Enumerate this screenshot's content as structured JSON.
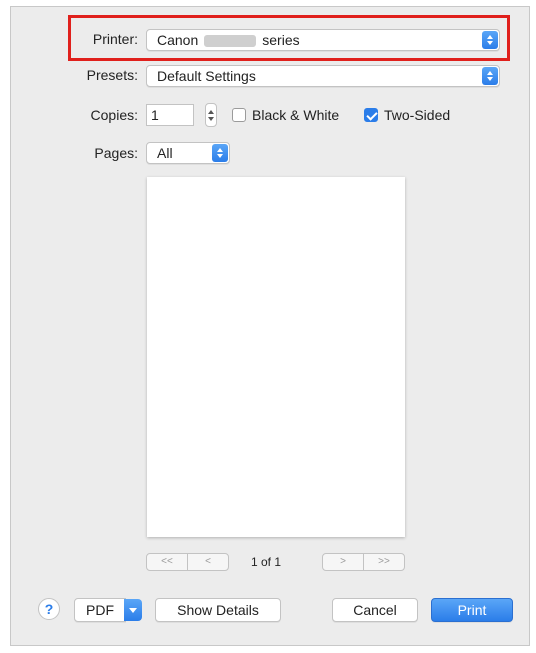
{
  "printer": {
    "label": "Printer:",
    "value_prefix": "Canon",
    "value_suffix": "series"
  },
  "presets": {
    "label": "Presets:",
    "value": "Default Settings"
  },
  "copies": {
    "label": "Copies:",
    "value": "1"
  },
  "options": {
    "black_white": {
      "label": "Black & White",
      "checked": false
    },
    "two_sided": {
      "label": "Two-Sided",
      "checked": true
    }
  },
  "pages": {
    "label": "Pages:",
    "value": "All"
  },
  "navigation": {
    "first": "<<",
    "prev": "<",
    "page_count": "1 of 1",
    "next": ">",
    "last": ">>"
  },
  "footer": {
    "help": "?",
    "pdf": "PDF",
    "show_details": "Show Details",
    "cancel": "Cancel",
    "print": "Print"
  },
  "colors": {
    "accent": "#2b7de9",
    "highlight": "#e0201c",
    "dialog_bg": "#ececec"
  }
}
